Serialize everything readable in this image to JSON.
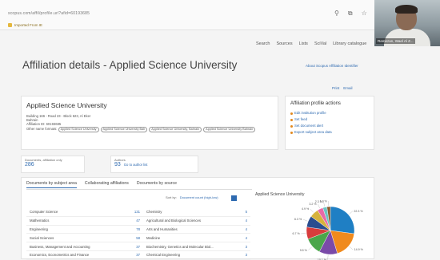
{
  "browser": {
    "url": "scopus.com/affil/profile.uri?afid=60193685",
    "bookmark": "Imported From IE",
    "icons": [
      "search-icon",
      "share-icon",
      "star-icon"
    ]
  },
  "webcam": {
    "name": "Ramezan, Wael Al Z..."
  },
  "topnav": [
    "Search",
    "Sources",
    "Lists",
    "SciVal",
    "Library catalogue"
  ],
  "page": {
    "title": "Affiliation details - Applied Science University",
    "about_link": "About Scopus Affiliation Identifier",
    "print": "Print",
    "email": "Email"
  },
  "affiliation": {
    "name": "Applied Science University",
    "address1": "Building 166 - Road 23 - Block 623, Al Eker",
    "address2": "Bahrain",
    "affil_id": "Affiliation ID: 60193685",
    "other_names_label": "Other name formats:",
    "other_names": [
      "Applied Science University",
      "Applied Science University Bah",
      "Applied Science University, Bahrain",
      "Applied Science University Bahrain"
    ]
  },
  "actions": {
    "title": "Affiliation profile actions",
    "items": [
      "Edit institution profile",
      "Set feed",
      "Set document alert",
      "Export subject area data"
    ]
  },
  "stats": {
    "docs_label": "Documents, affiliation only",
    "docs_value": "286",
    "authors_label": "Authors",
    "authors_value": "93",
    "authors_link": "Go to author list"
  },
  "tabs": [
    "Documents by subject area",
    "Collaborating affiliations",
    "Documents by source"
  ],
  "sort": {
    "label": "Sort by:",
    "value": "Document count (high-low)"
  },
  "subject_rows": [
    [
      "Computer Science",
      "131",
      "Chemistry",
      "5"
    ],
    [
      "Mathematics",
      "47",
      "Agricultural and Biological Sciences",
      "4"
    ],
    [
      "Engineering",
      "78",
      "Arts and Humanities",
      "4"
    ],
    [
      "Social Sciences",
      "58",
      "Medicine",
      "4"
    ],
    [
      "Business, Management and Accounting",
      "37",
      "Biochemistry, Genetics and Molecular Biol...",
      "3"
    ],
    [
      "Economics, Econometrics and Finance",
      "37",
      "Chemical Engineering",
      "3"
    ]
  ],
  "chart_data": {
    "type": "pie",
    "title": "Applied Science University",
    "slices": [
      {
        "label": "22.3 %",
        "value": 22.3,
        "color": "#1f7fc4"
      },
      {
        "label": "14.9 %",
        "value": 14.9,
        "color": "#f08a1d"
      },
      {
        "label": "10.1 %",
        "value": 10.1,
        "color": "#7a4aa8"
      },
      {
        "label": "9.5 %",
        "value": 9.5,
        "color": "#4aa64a"
      },
      {
        "label": "6.7 %",
        "value": 6.7,
        "color": "#d83c3c"
      },
      {
        "label": "6.3 %",
        "value": 6.3,
        "color": "#2a4d8f"
      },
      {
        "label": "4.9 %",
        "value": 4.9,
        "color": "#d6b23d"
      },
      {
        "label": "3.2 %",
        "value": 3.2,
        "color": "#e86aa8"
      },
      {
        "label": "2.3 %",
        "value": 2.3,
        "color": "#6cc3c3"
      },
      {
        "label": "1.9 %",
        "value": 1.9,
        "color": "#8b5a2b"
      }
    ]
  }
}
